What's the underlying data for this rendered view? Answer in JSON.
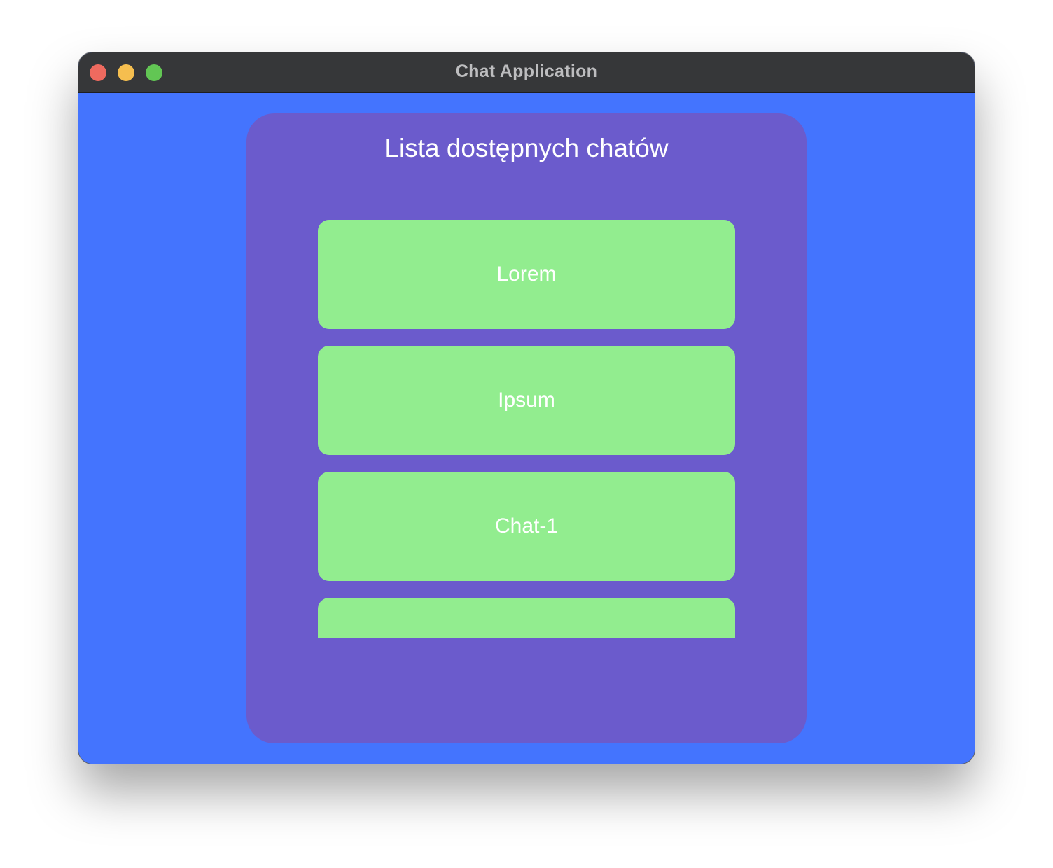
{
  "window": {
    "title": "Chat Application"
  },
  "panel": {
    "title": "Lista dostępnych chatów"
  },
  "chats": [
    {
      "label": "Lorem"
    },
    {
      "label": "Ipsum"
    },
    {
      "label": "Chat-1"
    },
    {
      "label": ""
    }
  ],
  "colors": {
    "background": "#4474fe",
    "panel": "#6b5bcc",
    "chat_item": "#92ed8f",
    "titlebar": "#363739"
  }
}
